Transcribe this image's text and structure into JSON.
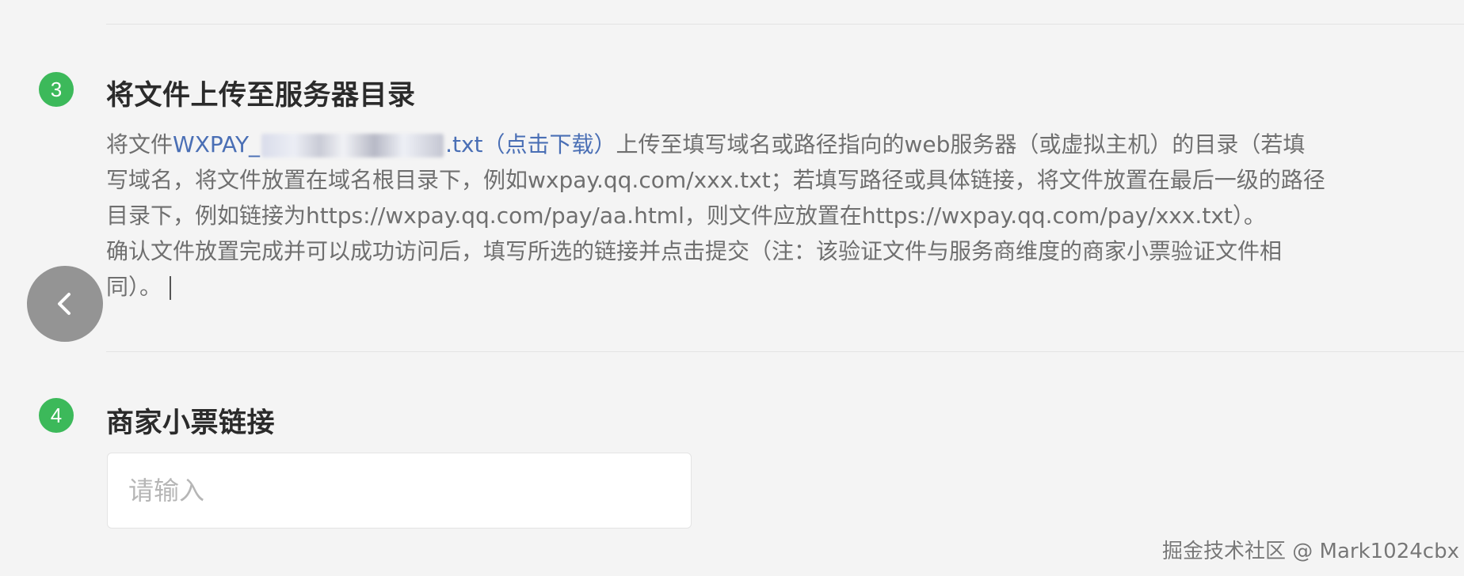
{
  "step3": {
    "number": "3",
    "title": "将文件上传至服务器目录",
    "line1": {
      "prefix": "将文件",
      "file_start": "WXPAY_",
      "file_end": ".txt（点击下载）",
      "suffix": "上传至填写域名或路径指向的web服务器（或虚拟主机）的目录（若填"
    },
    "line2": "写域名，将文件放置在域名根目录下，例如wxpay.qq.com/xxx.txt；若填写路径或具体链接，将文件放置在最后一级的路径",
    "line3": "目录下，例如链接为https://wxpay.qq.com/pay/aa.html，则文件应放置在https://wxpay.qq.com/pay/xxx.txt）。",
    "line4": "确认文件放置完成并可以成功访问后，填写所选的链接并点击提交（注：该验证文件与服务商维度的商家小票验证文件相",
    "line5": "同）。"
  },
  "step4": {
    "number": "4",
    "title": "商家小票链接",
    "input": {
      "value": "",
      "placeholder": "请输入"
    }
  },
  "back_button": {
    "icon": "chevron-left-icon"
  },
  "watermark": "掘金技术社区 @ Mark1024cbx",
  "colors": {
    "badge": "#3cb95a",
    "link": "#4a6fb5",
    "text": "#6f6f6f",
    "title": "#2b2b2b"
  }
}
